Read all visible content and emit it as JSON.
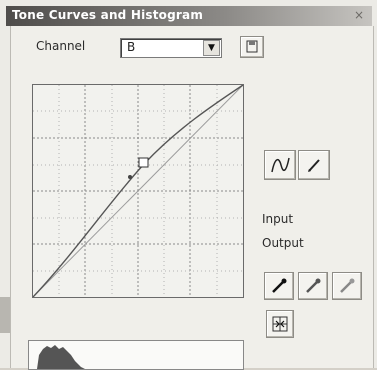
{
  "window": {
    "title": "Tone Curves and Histogram",
    "close_glyph": "×"
  },
  "channel": {
    "label": "Channel",
    "value": "B"
  },
  "io": {
    "input_label": "Input",
    "output_label": "Output"
  },
  "icons": {
    "save": "save-icon",
    "curve": "curve-tool-icon",
    "pencil": "pencil-tool-icon",
    "black_point": "black-eyedropper-icon",
    "gray_point": "gray-eyedropper-icon",
    "white_point": "white-eyedropper-icon",
    "reset": "reset-icon"
  }
}
